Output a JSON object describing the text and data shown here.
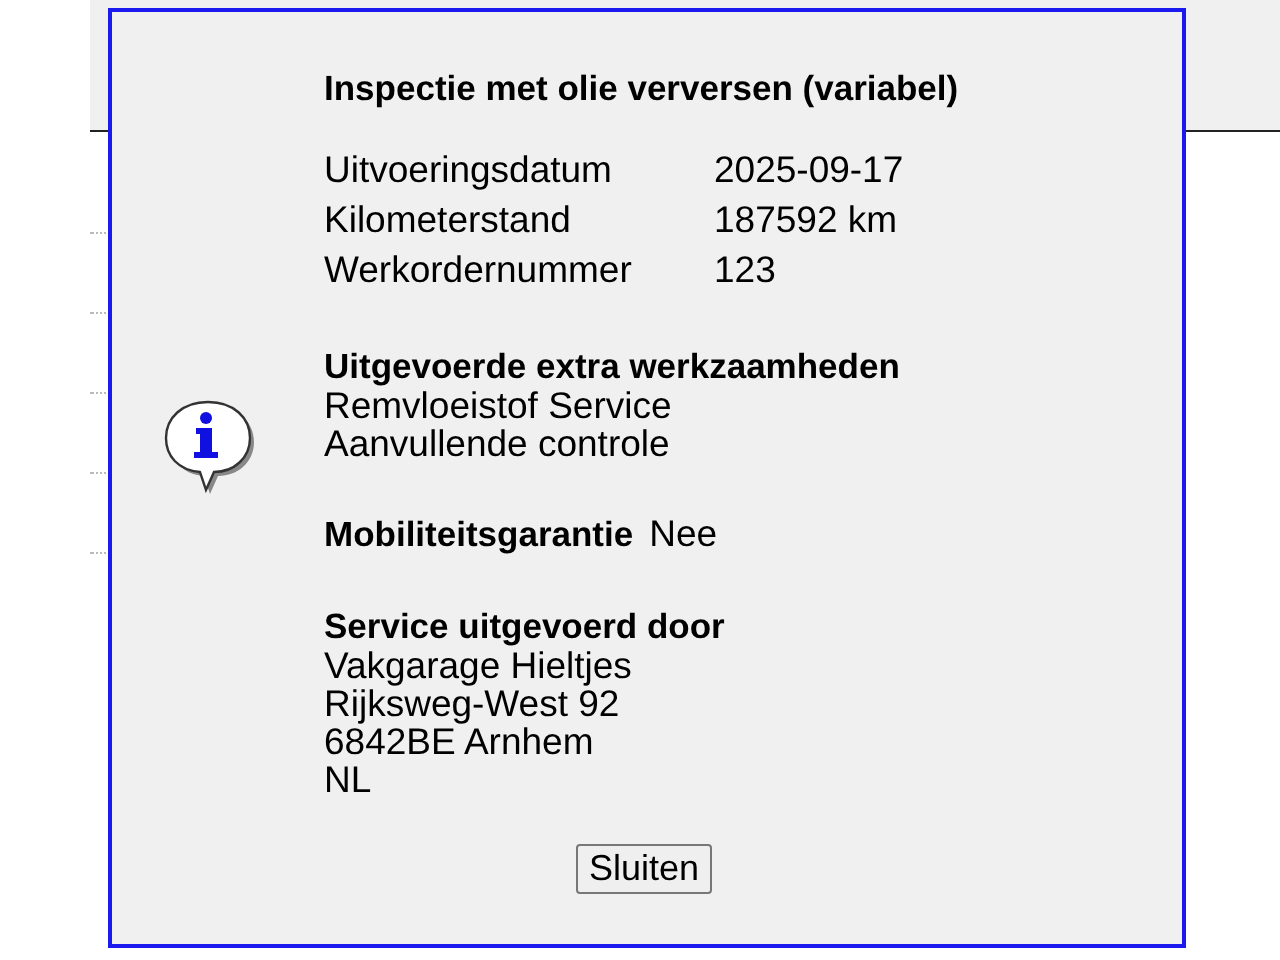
{
  "dialog": {
    "title": "Inspectie met olie verversen (variabel)",
    "details": [
      {
        "label": "Uitvoeringsdatum",
        "value": "2025-09-17"
      },
      {
        "label": "Kilometerstand",
        "value": "187592 km"
      },
      {
        "label": "Werkordernummer",
        "value": "123"
      }
    ],
    "extra_work": {
      "heading": "Uitgevoerde extra werkzaamheden",
      "items": [
        "Remvloeistof Service",
        "Aanvullende controle"
      ]
    },
    "mobility": {
      "label": "Mobiliteitsgarantie",
      "value": "Nee"
    },
    "performed_by": {
      "heading": "Service uitgevoerd door",
      "lines": [
        "Vakgarage Hieltjes",
        "Rijksweg-West 92",
        "6842BE Arnhem",
        "NL"
      ]
    },
    "close_button": "Sluiten"
  }
}
